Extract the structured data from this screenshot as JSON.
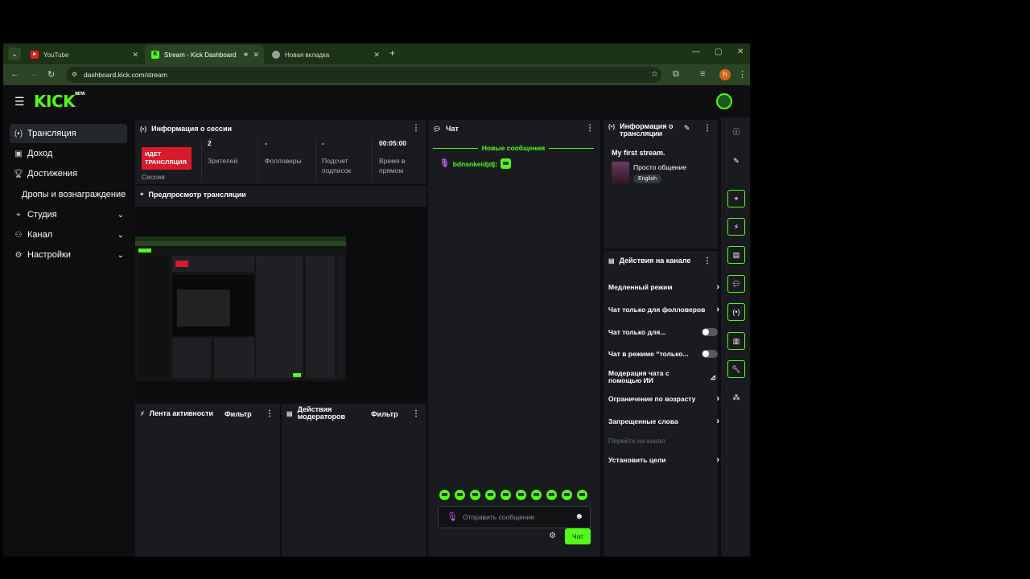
{
  "browser": {
    "tabs": [
      {
        "label": "YouTube",
        "favicon": "youtube-icon"
      },
      {
        "label": "Stream - Kick Dashboard",
        "favicon": "kick-icon"
      },
      {
        "label": "Новая вкладка",
        "favicon": "chrome-icon"
      }
    ],
    "url": "dashboard.kick.com/stream",
    "profile_initial": "h"
  },
  "app": {
    "logo": "KICK",
    "logo_badge": "BETA",
    "accent": "#53fc18"
  },
  "sidebar": {
    "items": [
      {
        "label": "Трансляция",
        "icon": "broadcast-icon"
      },
      {
        "label": "Доход",
        "icon": "wallet-icon"
      },
      {
        "label": "Достижения",
        "icon": "trophy-icon"
      },
      {
        "label": "Дропы и вознаграждение",
        "icon": ""
      },
      {
        "label": "Студия",
        "icon": "studio-icon"
      },
      {
        "label": "Канал",
        "icon": "channel-icon"
      },
      {
        "label": "Настройки",
        "icon": "gear-icon"
      }
    ]
  },
  "session": {
    "title": "Информация о сессии",
    "live_badge": "ИДЕТ ТРАНСЛЯЦИЯ",
    "session_label": "Сессия",
    "stats": [
      {
        "value": "2",
        "label": "Зрителей"
      },
      {
        "value": "-",
        "label": "Фолловеры"
      },
      {
        "value": "-",
        "label": "Подсчет подписок"
      },
      {
        "value": "00:05:00",
        "label": "Время в прямом"
      }
    ]
  },
  "preview": {
    "title": "Предпросмотр трансляции"
  },
  "activity": {
    "title": "Лента активности",
    "filter": "Фильтр"
  },
  "modactions": {
    "title": "Действия модераторов",
    "filter": "Фильтр"
  },
  "chat": {
    "title": "Чат",
    "new_messages": "Новые сообщения",
    "messages": [
      {
        "user": "bdnsnkeidjdj",
        "sep": ":"
      }
    ],
    "input_placeholder": "Отправить сообщение",
    "send_label": "Чат"
  },
  "streaminfo": {
    "title": "Информация о трансляции",
    "stream_title": "My first stream.",
    "category": "Просто общение",
    "language": "English"
  },
  "channel_actions": {
    "title": "Действия на канале",
    "items": [
      {
        "label": "Медленный режим",
        "control": "chevron"
      },
      {
        "label": "Чат только для фолловеров",
        "control": "chevron"
      },
      {
        "label": "Чат только для...",
        "control": "toggle"
      },
      {
        "label": "Чат в режиме “только...",
        "control": "toggle"
      },
      {
        "label": "Модерация чата с помощью ИИ",
        "control": "chart"
      },
      {
        "label": "Ограничение по возрасту",
        "control": "chevron"
      },
      {
        "label": "Запрещенные слова",
        "control": "chevron"
      },
      {
        "label": "Перейти на канал",
        "control": "none"
      },
      {
        "label": "Установить цели",
        "control": "chevron"
      }
    ]
  }
}
